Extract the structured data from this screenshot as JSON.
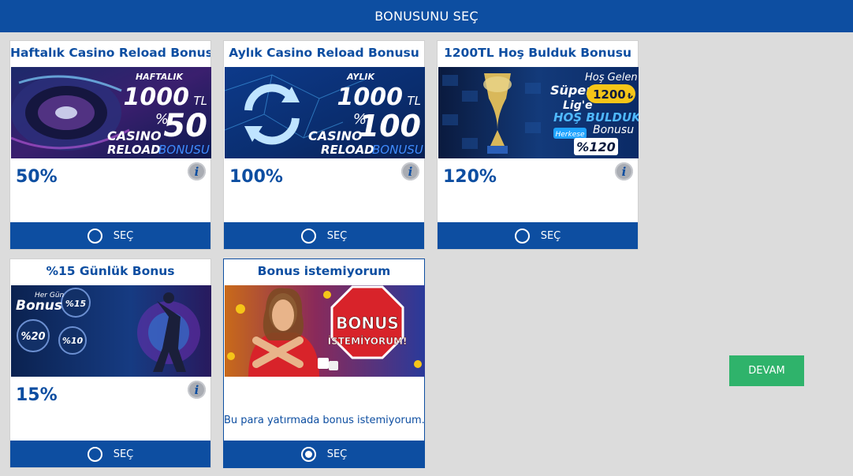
{
  "header": {
    "title": "BONUSUNU SEÇ"
  },
  "colors": {
    "primary": "#0d4ea1",
    "accent_green": "#2fb36b",
    "background": "#dcdcdc"
  },
  "cards": [
    {
      "title": "Haftalık Casino Reload Bonusu",
      "percent": "50%",
      "banner": {
        "line1": "HAFTALIK",
        "line2": "1000",
        "line2_unit": "TL",
        "line3_prefix": "%",
        "line3": "50",
        "line4": "CASINO",
        "line5a": "RELOAD",
        "line5b": "BONUSU"
      },
      "select_label": "SEÇ",
      "selected": false,
      "info_icon": "info-icon"
    },
    {
      "title": "Aylık Casino Reload Bonusu",
      "percent": "100%",
      "banner": {
        "line1": "AYLIK",
        "line2": "1000",
        "line2_unit": "TL",
        "line3_prefix": "%",
        "line3": "100",
        "line4": "CASINO",
        "line5a": "RELOAD",
        "line5b": "BONUSU"
      },
      "select_label": "SEÇ",
      "selected": false,
      "info_icon": "info-icon"
    },
    {
      "title": "1200TL Hoş Bulduk Bonusu",
      "percent": "120%",
      "banner": {
        "l1": "Süper",
        "l2": "Lig'e",
        "l3": "Hoş Gelen",
        "l4": "1200",
        "l4_unit": "₺",
        "l5": "HOŞ BULDUK",
        "l6": "Bonusu",
        "l7": "Herkese",
        "l8": "%120"
      },
      "select_label": "SEÇ",
      "selected": false,
      "info_icon": "info-icon"
    },
    {
      "title": "%15 Günlük Bonus",
      "percent": "15%",
      "banner": {
        "l1": "Her Gün",
        "l2": "Bonus",
        "l3": "%15",
        "l4": "%20",
        "l5": "%10"
      },
      "select_label": "SEÇ",
      "selected": false,
      "info_icon": "info-icon"
    },
    {
      "title": "Bonus istemiyorum",
      "description": "Bu para yatırmada bonus istemiyorum.",
      "banner": {
        "l1": "BONUS",
        "l2": "İSTEMİYORUM!"
      },
      "select_label": "SEÇ",
      "selected": true
    }
  ],
  "continue_button": {
    "label": "DEVAM"
  }
}
